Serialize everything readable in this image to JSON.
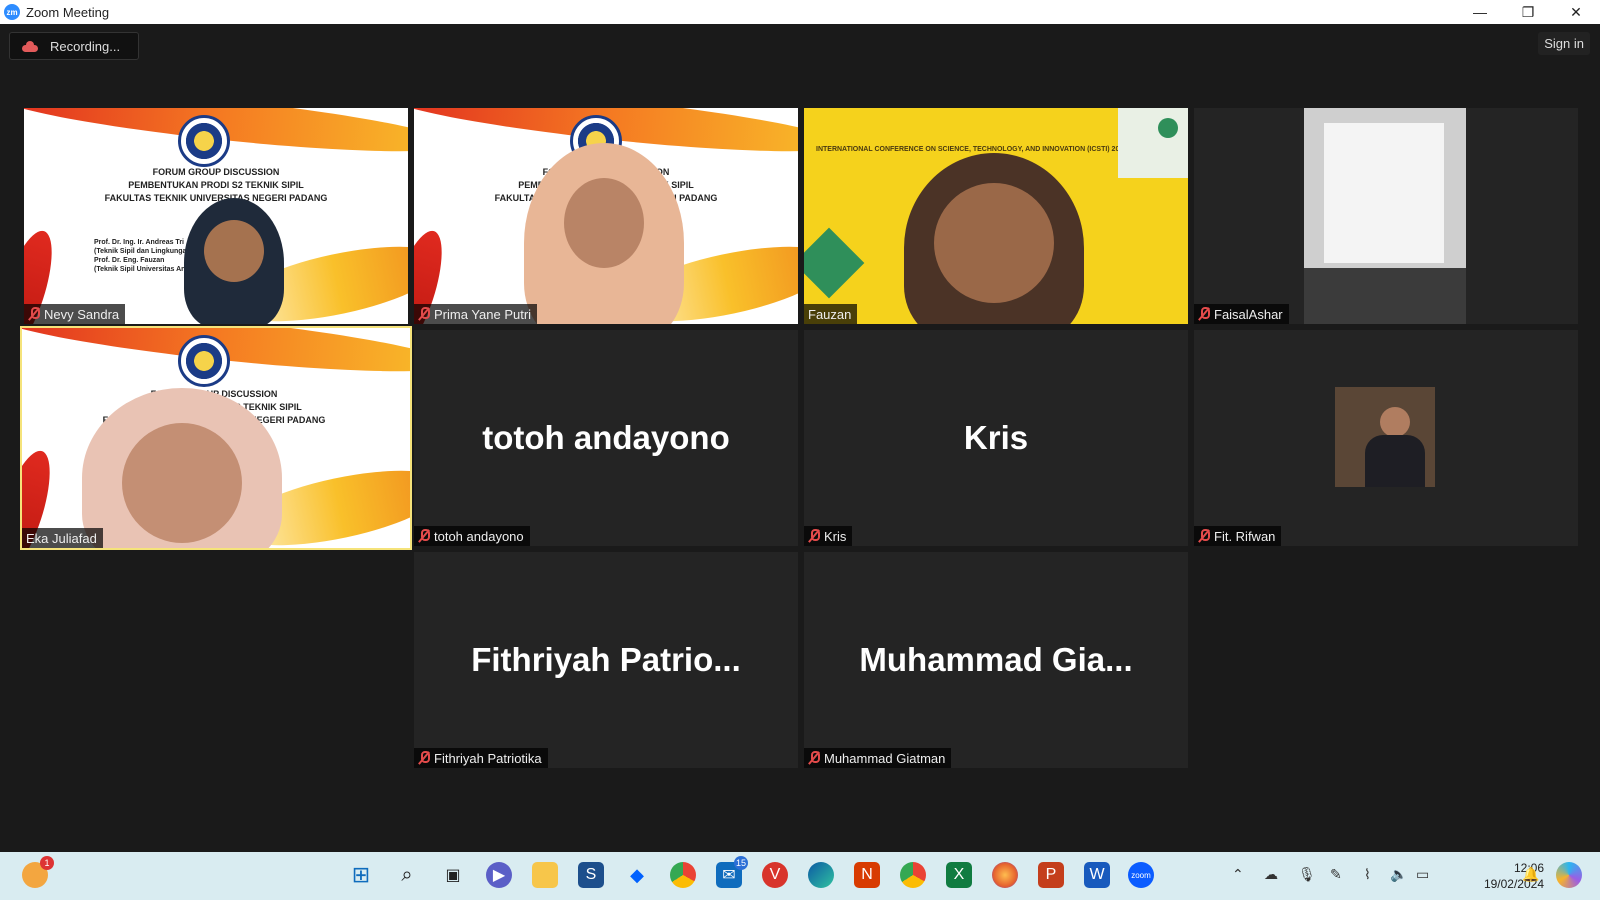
{
  "window": {
    "title": "Zoom Meeting",
    "logo_text": "zm",
    "minimize": "—",
    "restore": "❐",
    "close": "✕"
  },
  "topbar": {
    "recording_label": "Recording...",
    "sign_in": "Sign in"
  },
  "tiles": [
    {
      "name": "Nevy Sandra",
      "type": "video-slide"
    },
    {
      "name": "Prima Yane Putri",
      "type": "video-slide"
    },
    {
      "name": "Fauzan",
      "type": "video-conference"
    },
    {
      "name": "FaisalAshar",
      "type": "video-projector"
    },
    {
      "name": "Eka Juliafad",
      "type": "video-slide",
      "active": true
    },
    {
      "name": "totoh andayono",
      "display": "totoh andayono",
      "type": "name-only"
    },
    {
      "name": "Kris",
      "display": "Kris",
      "type": "name-only"
    },
    {
      "name": "Fit. Rifwan",
      "type": "profile-photo"
    },
    {
      "name": "Fithriyah Patriotika",
      "display": "Fithriyah  Patrio...",
      "type": "name-only"
    },
    {
      "name": "Muhammad Giatman",
      "display": "Muhammad  Gia...",
      "type": "name-only"
    }
  ],
  "slide": {
    "line1": "FORUM GROUP DISCUSSION",
    "line2": "PEMBENTUKAN PRODI S2 TEKNIK SIPIL",
    "line3": "FAKULTAS TEKNIK UNIVERSITAS NEGERI PADANG",
    "presenters": [
      "Prof. Dr. Ing. Ir. Andreas Tri",
      "(Teknik Sipil dan Lingkungan",
      "Prof. Dr. Eng. Fauzan",
      "(Teknik Sipil Universitas An"
    ],
    "emblem_text": "UNP"
  },
  "conference_slide": {
    "title": "INTERNATIONAL CONFERENCE ON SCIENCE, TECHNOLOGY, AND INNOVATION (ICSTI) 2023"
  },
  "taskbar": {
    "icons": [
      "notifications-app-icon",
      "windows-start-icon",
      "search-icon",
      "task-view-icon",
      "meet-icon",
      "file-explorer-icon",
      "sketchup-icon",
      "dropbox-icon",
      "chrome-icon",
      "mail-icon",
      "app-v-icon",
      "edge-icon",
      "office-icon",
      "chrome-alt-icon",
      "excel-icon",
      "firefox-icon",
      "powerpoint-icon",
      "word-icon",
      "zoom-icon"
    ],
    "mail_badge": "15",
    "notif_badge": "1",
    "time": "12:06",
    "date": "19/02/2024"
  },
  "colors": {
    "background": "#1a1a1a",
    "tile": "#242424",
    "active_border": "#f5e37a",
    "muted_mic": "#e34b4b",
    "taskbar": "#d9ecf1"
  }
}
